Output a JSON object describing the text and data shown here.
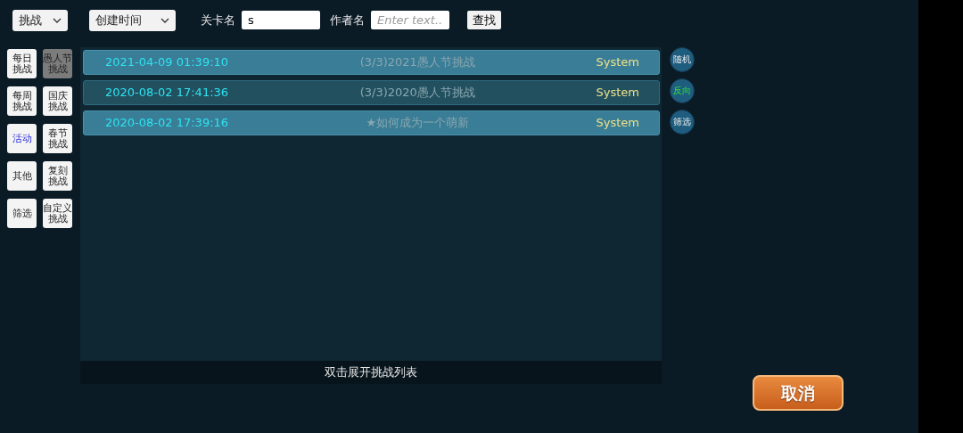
{
  "filters": {
    "mode": "挑战",
    "sort": "创建时间",
    "level_label": "关卡名",
    "level_value": "s",
    "author_label": "作者名",
    "author_placeholder": "Enter text...",
    "search_button": "查找"
  },
  "categories": [
    {
      "label": "每日挑战",
      "selected": false,
      "active": false
    },
    {
      "label": "愚人节挑战",
      "selected": true,
      "active": false
    },
    {
      "label": "每周挑战",
      "selected": false,
      "active": false
    },
    {
      "label": "国庆挑战",
      "selected": false,
      "active": false
    },
    {
      "label": "活动",
      "selected": false,
      "active": true
    },
    {
      "label": "春节挑战",
      "selected": false,
      "active": false
    },
    {
      "label": "其他",
      "selected": false,
      "active": false
    },
    {
      "label": "复刻挑战",
      "selected": false,
      "active": false
    },
    {
      "label": "筛选",
      "selected": false,
      "active": false
    },
    {
      "label": "自定义挑战",
      "selected": false,
      "active": false
    }
  ],
  "challenges": [
    {
      "created": "2021-04-09 01:39:10",
      "title": "(3/3)2021愚人节挑战",
      "author": "System",
      "selected": true
    },
    {
      "created": "2020-08-02 17:41:36",
      "title": "(3/3)2020愚人节挑战",
      "author": "System",
      "selected": false
    },
    {
      "created": "2020-08-02 17:39:16",
      "title": "★如何成为一个萌新",
      "author": "System",
      "selected": true
    }
  ],
  "list_hint": "双击展开挑战列表",
  "side_buttons": [
    {
      "label": "随机",
      "on": false
    },
    {
      "label": "反向",
      "on": true
    },
    {
      "label": "筛选",
      "on": false
    }
  ],
  "cancel_button": "取消"
}
